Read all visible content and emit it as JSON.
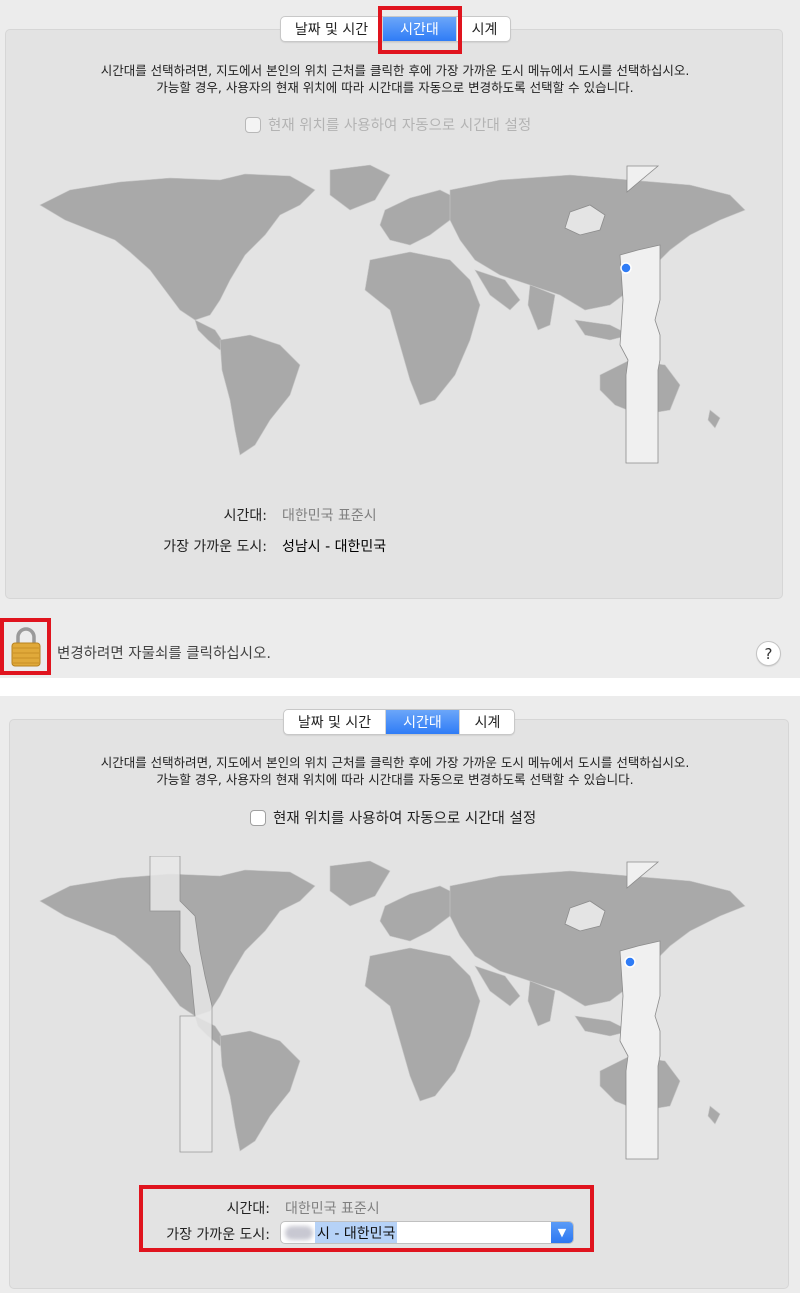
{
  "tabs": {
    "date_time": "날짜 및 시간",
    "time_zone": "시간대",
    "clock": "시계"
  },
  "description": {
    "line1": "시간대를 선택하려면, 지도에서 본인의 위치 근처를 클릭한 후에 가장 가까운 도시 메뉴에서 도시를 선택하십시오.",
    "line2": "가능할 경우, 사용자의 현재 위치에 따라 시간대를 자동으로 변경하도록 선택할 수 있습니다."
  },
  "auto_checkbox_label": "현재 위치를 사용하여 자동으로 시간대 설정",
  "auto_checkbox_checked": false,
  "time_zone_label": "시간대:",
  "time_zone_value": "대한민국 표준시",
  "closest_city_label": "가장 가까운 도시:",
  "screen1": {
    "closest_city_value": "성남시 - 대한민국",
    "lock_text": "변경하려면 자물쇠를 클릭하십시오.",
    "help": "?"
  },
  "screen2": {
    "closest_city_value": "시 - 대한민국"
  },
  "colors": {
    "accent": "#2f7cf6",
    "highlight": "#e0141e",
    "land": "#a8a8a8",
    "selected_zone": "#f2f2f2"
  }
}
